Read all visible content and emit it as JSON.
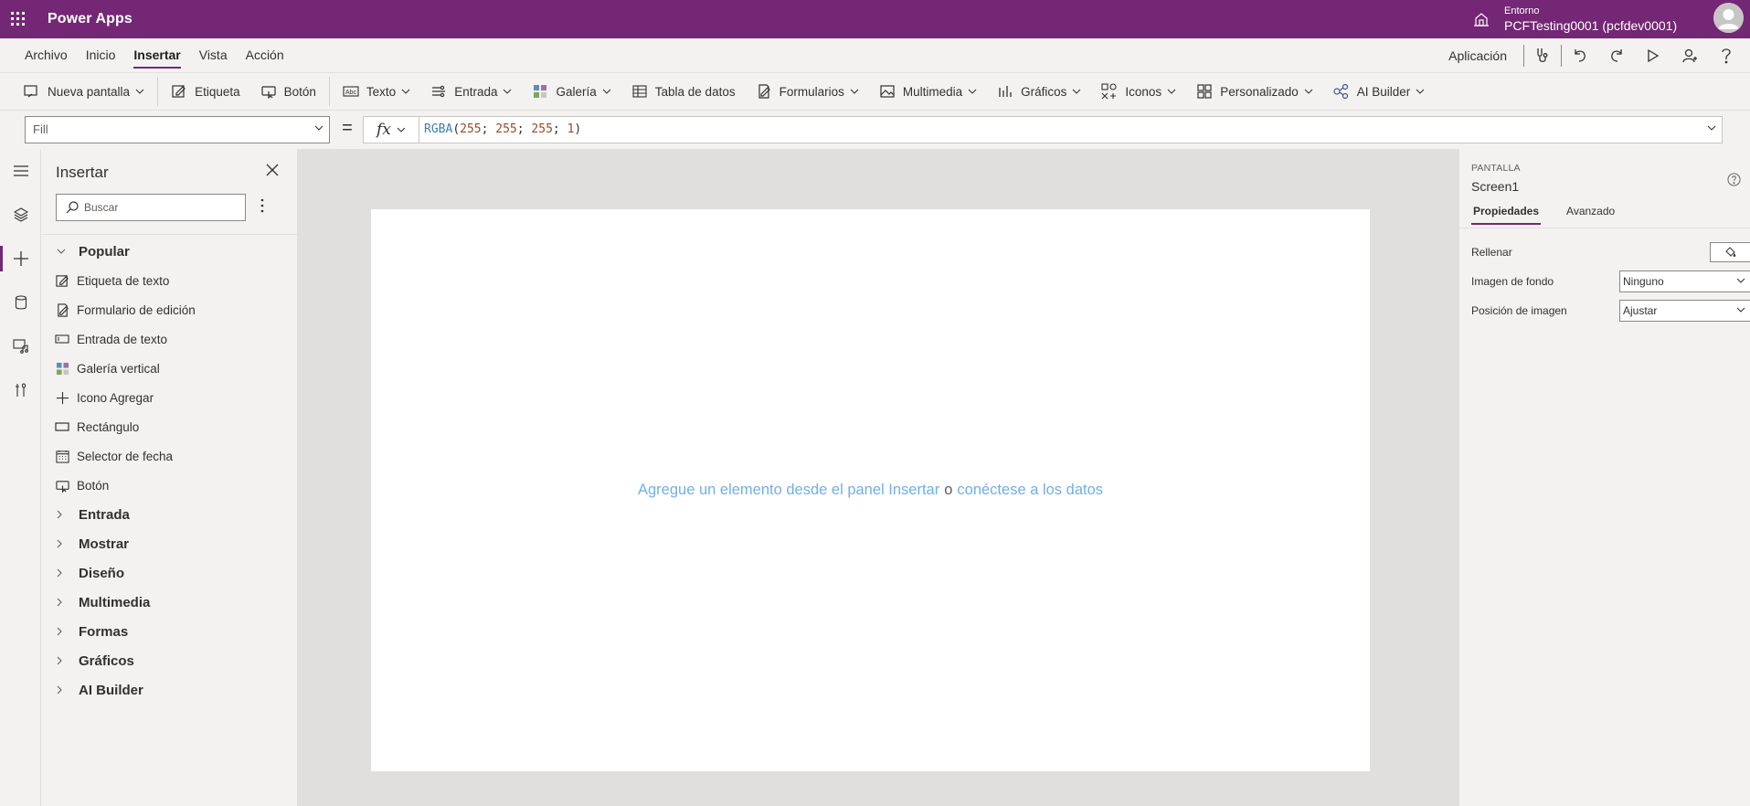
{
  "app": {
    "title": "Power Apps"
  },
  "environment": {
    "label": "Entorno",
    "name": "PCFTesting0001 (pcfdev0001)"
  },
  "menu": {
    "items": [
      "Archivo",
      "Inicio",
      "Insertar",
      "Vista",
      "Acción"
    ],
    "active": "Insertar",
    "right_label": "Aplicación"
  },
  "ribbon": {
    "nueva_pantalla": "Nueva pantalla",
    "etiqueta": "Etiqueta",
    "boton": "Botón",
    "texto": "Texto",
    "entrada": "Entrada",
    "galeria": "Galería",
    "tabla": "Tabla de datos",
    "formularios": "Formularios",
    "multimedia": "Multimedia",
    "graficos": "Gráficos",
    "iconos": "Iconos",
    "personalizado": "Personalizado",
    "ai_builder": "AI Builder"
  },
  "formula_bar": {
    "property": "Fill",
    "equals": "=",
    "fx": "fx",
    "fn": "RGBA",
    "args": [
      "255",
      "255",
      "255",
      "1"
    ]
  },
  "insert_panel": {
    "title": "Insertar",
    "search_placeholder": "Buscar",
    "popular_label": "Popular",
    "popular_items": [
      "Etiqueta de texto",
      "Formulario de edición",
      "Entrada de texto",
      "Galería vertical",
      "Icono Agregar",
      "Rectángulo",
      "Selector de fecha",
      "Botón"
    ],
    "groups": [
      "Entrada",
      "Mostrar",
      "Diseño",
      "Multimedia",
      "Formas",
      "Gráficos",
      "AI Builder"
    ]
  },
  "canvas": {
    "hint_part1": "Agregue un elemento desde el panel Insertar",
    "hint_or": "o",
    "hint_part2": "conéctese a los datos"
  },
  "properties": {
    "kind": "PANTALLA",
    "name": "Screen1",
    "tabs": [
      "Propiedades",
      "Avanzado"
    ],
    "fill_label": "Rellenar",
    "bg_image_label": "Imagen de fondo",
    "bg_image_value": "Ninguno",
    "img_pos_label": "Posición de imagen",
    "img_pos_value": "Ajustar"
  }
}
